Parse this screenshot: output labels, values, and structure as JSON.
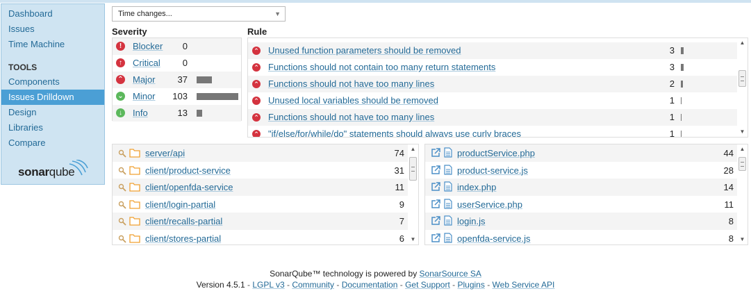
{
  "sidebar": {
    "items_top": [
      "Dashboard",
      "Issues",
      "Time Machine"
    ],
    "tools_heading": "TOOLS",
    "tools_items": [
      "Components",
      "Issues Drilldown",
      "Design",
      "Libraries",
      "Compare"
    ],
    "active_item": "Issues Drilldown",
    "logo_text_bold": "sonar",
    "logo_text_thin": "qube"
  },
  "time_select": {
    "value": "Time changes..."
  },
  "severity": {
    "title": "Severity",
    "rows": [
      {
        "label": "Blocker",
        "count": "0",
        "bar": 0,
        "icon": "blocker-icon",
        "color": "#d4333f",
        "glyph": "!"
      },
      {
        "label": "Critical",
        "count": "0",
        "bar": 0,
        "icon": "critical-icon",
        "color": "#d4333f",
        "glyph": "↑"
      },
      {
        "label": "Major",
        "count": "37",
        "bar": 0.36,
        "icon": "major-icon",
        "color": "#d4333f",
        "glyph": "⌃"
      },
      {
        "label": "Minor",
        "count": "103",
        "bar": 1.0,
        "icon": "minor-icon",
        "color": "#5cb85c",
        "glyph": "⌄"
      },
      {
        "label": "Info",
        "count": "13",
        "bar": 0.13,
        "icon": "info-icon",
        "color": "#5cb85c",
        "glyph": "↓"
      }
    ]
  },
  "rules": {
    "title": "Rule",
    "rows": [
      {
        "label": "Unused function parameters should be removed",
        "count": "3",
        "bar": 1.0
      },
      {
        "label": "Functions should not contain too many return statements",
        "count": "3",
        "bar": 1.0
      },
      {
        "label": "Functions should not have too many lines",
        "count": "2",
        "bar": 0.67
      },
      {
        "label": "Unused local variables should be removed",
        "count": "1",
        "bar": 0.33
      },
      {
        "label": "Functions should not have too many lines",
        "count": "1",
        "bar": 0.33
      },
      {
        "label": "\"if/else/for/while/do\" statements should always use curly braces",
        "count": "1",
        "bar": 0.33
      }
    ]
  },
  "directories": [
    {
      "label": "server/api",
      "count": "74"
    },
    {
      "label": "client/product-service",
      "count": "31"
    },
    {
      "label": "client/openfda-service",
      "count": "11"
    },
    {
      "label": "client/login-partial",
      "count": "9"
    },
    {
      "label": "client/recalls-partial",
      "count": "7"
    },
    {
      "label": "client/stores-partial",
      "count": "6"
    }
  ],
  "files": [
    {
      "label": "productService.php",
      "count": "44"
    },
    {
      "label": "product-service.js",
      "count": "28"
    },
    {
      "label": "index.php",
      "count": "14"
    },
    {
      "label": "userService.php",
      "count": "11"
    },
    {
      "label": "login.js",
      "count": "8"
    },
    {
      "label": "openfda-service.js",
      "count": "8"
    }
  ],
  "footer": {
    "line1_prefix": "SonarQube™ technology is powered by",
    "line1_link": "SonarSource SA",
    "version": "Version 4.5.1",
    "links": [
      "LGPL v3",
      "Community",
      "Documentation",
      "Get Support",
      "Plugins",
      "Web Service API"
    ],
    "separator": "-"
  },
  "colors": {
    "link": "#236a97",
    "sidebar_bg": "#cfe4f2",
    "active": "#4b9fd5",
    "bar": "#777777",
    "folder": "#f0a030",
    "file": "#4b8fc7"
  }
}
